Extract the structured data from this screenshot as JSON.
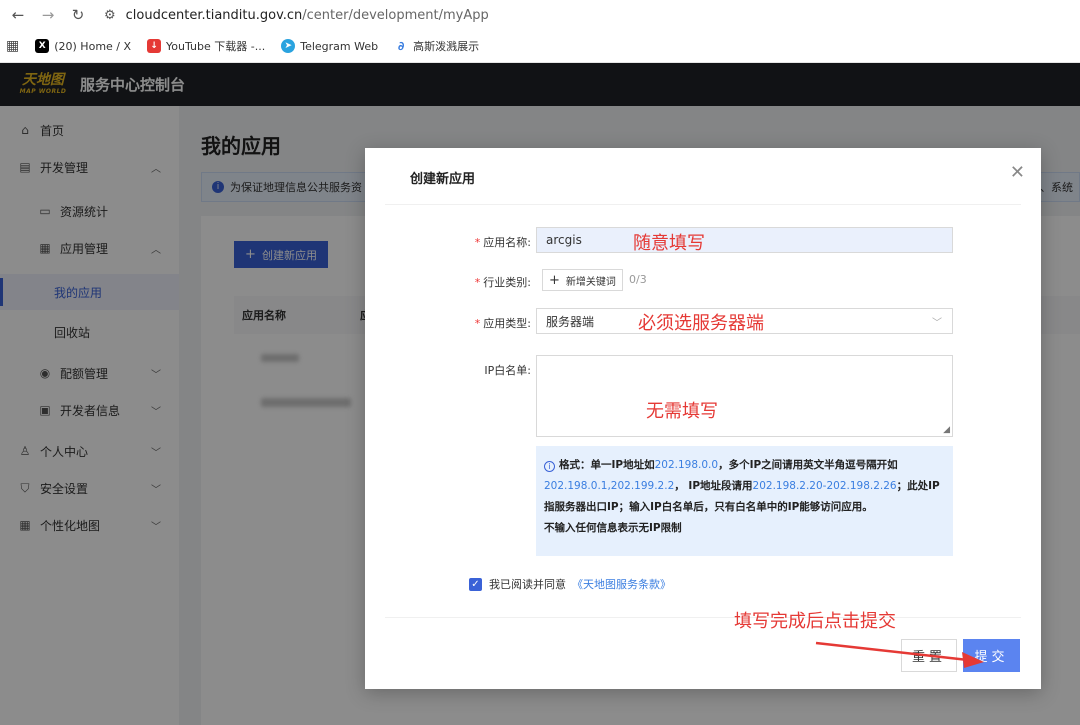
{
  "browser": {
    "url_host": "cloudcenter.tianditu.gov.cn",
    "url_path": "/center/development/myApp",
    "bookmarks": [
      {
        "label": "(20) Home / X"
      },
      {
        "label": "YouTube 下载器 -..."
      },
      {
        "label": "Telegram Web"
      },
      {
        "label": "高斯泼溅展示"
      }
    ]
  },
  "header": {
    "logo_cn": "天地图",
    "logo_en": "MAP WORLD",
    "title": "服务中心控制台"
  },
  "sidebar": {
    "items": [
      {
        "label": "首页",
        "icon": "home-icon"
      },
      {
        "label": "开发管理",
        "icon": "doc-icon"
      },
      {
        "label": "资源统计",
        "icon": "monitor-icon"
      },
      {
        "label": "应用管理",
        "icon": "grid-icon"
      },
      {
        "label": "我的应用"
      },
      {
        "label": "回收站"
      },
      {
        "label": "配额管理",
        "icon": "eye-icon"
      },
      {
        "label": "开发者信息",
        "icon": "id-icon"
      },
      {
        "label": "个人中心",
        "icon": "user-icon"
      },
      {
        "label": "安全设置",
        "icon": "shield-icon"
      },
      {
        "label": "个性化地图",
        "icon": "grid-icon"
      }
    ]
  },
  "main": {
    "page_title": "我的应用",
    "notice": "为保证地理信息公共服务资",
    "notice_tail": "个、系统",
    "create_button": "创建新应用",
    "table_headers": [
      "应用名称",
      "应"
    ]
  },
  "modal": {
    "title": "创建新应用",
    "fields": {
      "app_name_label": "应用名称:",
      "app_name_value": "arcgis",
      "industry_label": "行业类别:",
      "add_keyword": "新增关键词",
      "keyword_count": "0/3",
      "app_type_label": "应用类型:",
      "app_type_value": "服务器端",
      "ip_whitelist_label": "IP白名单:"
    },
    "hint": {
      "prefix": "格式：单一IP地址如",
      "ip_single": "202.198.0.0",
      "mid1": "，多个IP之间请用英文半角逗号隔开如",
      "ip_multi": "202.198.0.1,202.199.2.2",
      "mid2": "，  IP地址段请用",
      "ip_range": "202.198.2.20-202.198.2.26",
      "mid3": "；此处IP指服务器出口IP；输入IP白名单后，只有白名单中的IP能够访问应用。",
      "line_last": "不输入任何信息表示无IP限制"
    },
    "agree_text": "我已阅读并同意",
    "agree_link": "《天地图服务条款》",
    "reset_button": "重置",
    "submit_button": "提交"
  },
  "annotations": {
    "name": "随意填写",
    "type": "必须选服务器端",
    "ip": "无需填写",
    "submit": "填写完成后点击提交",
    "color": "#e53935"
  }
}
